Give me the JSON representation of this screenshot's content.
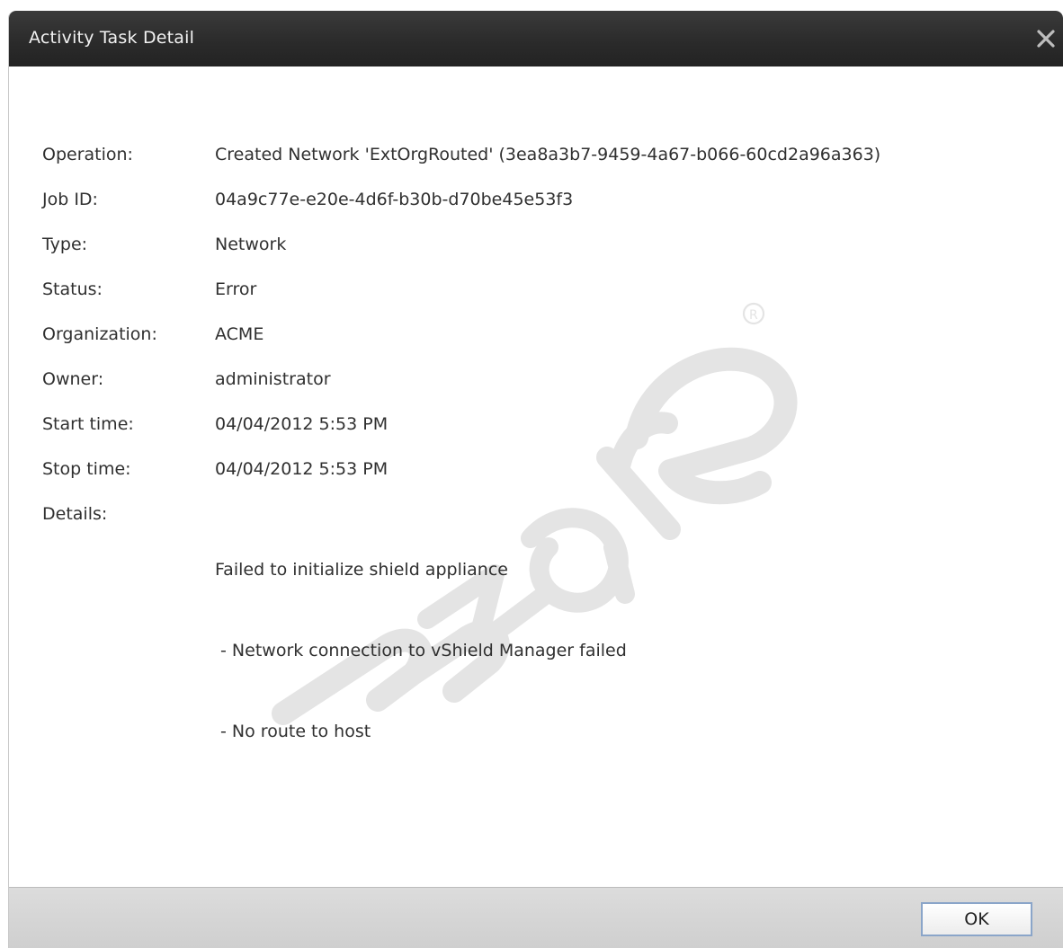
{
  "dialog": {
    "title": "Activity Task Detail",
    "close_icon": "close-icon",
    "ok_label": "OK"
  },
  "fields": {
    "operation": {
      "label": "Operation:",
      "value": "Created Network 'ExtOrgRouted' (3ea8a3b7-9459-4a67-b066-60cd2a96a363)"
    },
    "job_id": {
      "label": "Job ID:",
      "value": "04a9c77e-e20e-4d6f-b30b-d70be45e53f3"
    },
    "type": {
      "label": "Type:",
      "value": "Network"
    },
    "status": {
      "label": "Status:",
      "value": "Error"
    },
    "organization": {
      "label": "Organization:",
      "value": "ACME"
    },
    "owner": {
      "label": "Owner:",
      "value": "administrator"
    },
    "start_time": {
      "label": "Start time:",
      "value": "04/04/2012 5:53 PM"
    },
    "stop_time": {
      "label": "Stop time:",
      "value": "04/04/2012 5:53 PM"
    },
    "details": {
      "label": "Details:",
      "lines": [
        "Failed to initialize shield appliance",
        " - Network connection to vShield Manager failed",
        " - No route to host"
      ]
    }
  },
  "watermark": {
    "text": "vmware",
    "color": "#e2e2e2"
  }
}
